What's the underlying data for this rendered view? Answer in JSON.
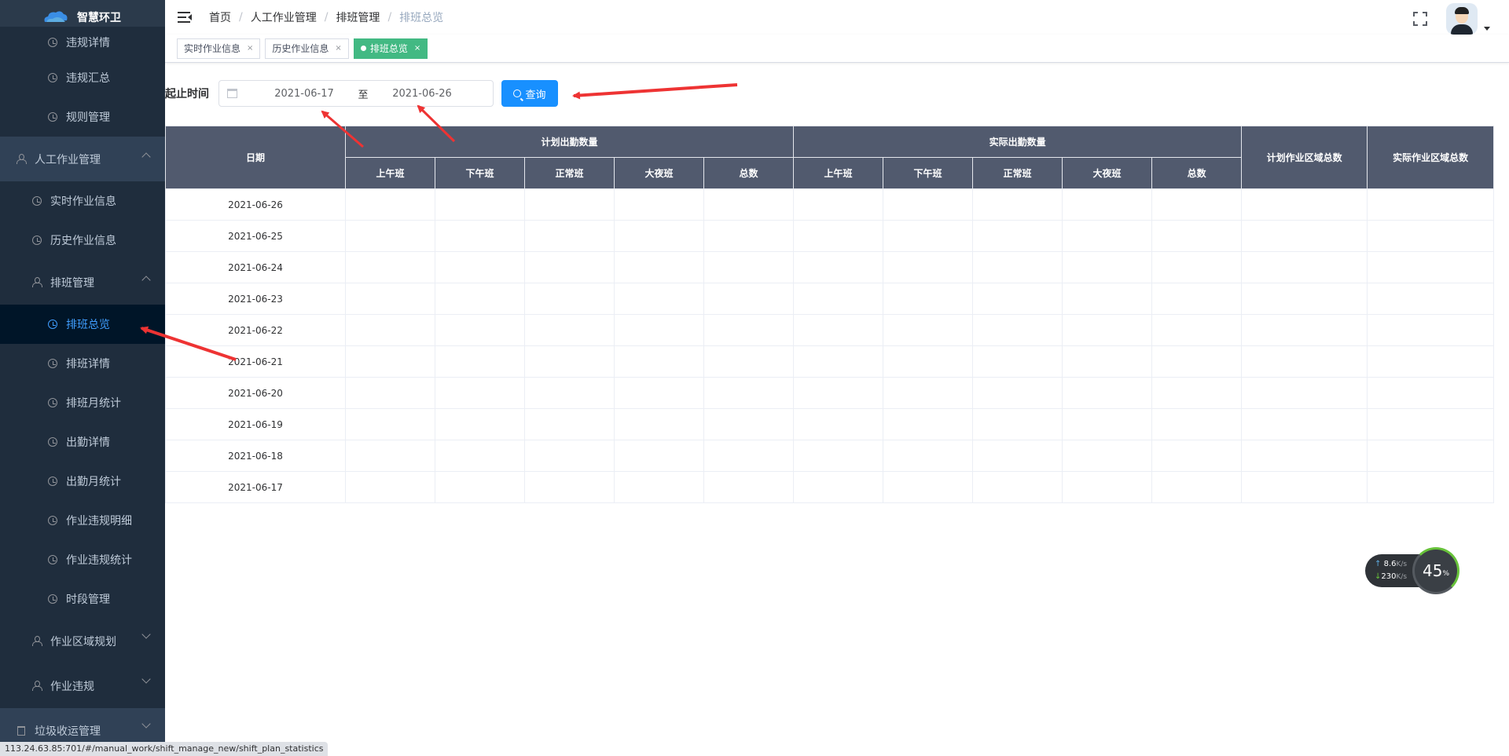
{
  "app": {
    "title": "智慧环卫"
  },
  "sidebar": {
    "items": [
      {
        "label": "违规详情",
        "level": 3,
        "icon": "clock-icon"
      },
      {
        "label": "违规汇总",
        "level": 3,
        "icon": "clock-icon"
      },
      {
        "label": "规则管理",
        "level": 3,
        "icon": "clock-icon"
      },
      {
        "label": "人工作业管理",
        "level": 1,
        "icon": "person-icon",
        "expanded": true
      },
      {
        "label": "实时作业信息",
        "level": 2,
        "icon": "clock-icon"
      },
      {
        "label": "历史作业信息",
        "level": 2,
        "icon": "clock-icon"
      },
      {
        "label": "排班管理",
        "level": 2,
        "icon": "person-icon",
        "expanded": true
      },
      {
        "label": "排班总览",
        "level": 3,
        "icon": "clock-icon",
        "active": true
      },
      {
        "label": "排班详情",
        "level": 3,
        "icon": "clock-icon"
      },
      {
        "label": "排班月统计",
        "level": 3,
        "icon": "clock-icon"
      },
      {
        "label": "出勤详情",
        "level": 3,
        "icon": "clock-icon"
      },
      {
        "label": "出勤月统计",
        "level": 3,
        "icon": "clock-icon"
      },
      {
        "label": "作业违规明细",
        "level": 3,
        "icon": "clock-icon"
      },
      {
        "label": "作业违规统计",
        "level": 3,
        "icon": "clock-icon"
      },
      {
        "label": "时段管理",
        "level": 3,
        "icon": "clock-icon"
      },
      {
        "label": "作业区域规划",
        "level": 2,
        "icon": "person-icon",
        "expanded": false
      },
      {
        "label": "作业违规",
        "level": 2,
        "icon": "person-icon",
        "expanded": false
      },
      {
        "label": "垃圾收运管理",
        "level": 1,
        "icon": "trash-icon",
        "expanded": false
      }
    ]
  },
  "header": {
    "breadcrumb": [
      "首页",
      "人工作业管理",
      "排班管理",
      "排班总览"
    ],
    "separator": "/"
  },
  "tags": [
    {
      "label": "实时作业信息",
      "active": false
    },
    {
      "label": "历史作业信息",
      "active": false
    },
    {
      "label": "排班总览",
      "active": true
    }
  ],
  "tag_close": "×",
  "filter": {
    "label": "起止时间",
    "start": "2021-06-17",
    "to": "至",
    "end": "2021-06-26",
    "query_label": "查询"
  },
  "table": {
    "date_header": "日期",
    "planned_header": "计划出勤数量",
    "actual_header": "实际出勤数量",
    "planned_area_header": "计划作业区域总数",
    "actual_area_header": "实际作业区域总数",
    "shift_headers": [
      "上午班",
      "下午班",
      "正常班",
      "大夜班",
      "总数"
    ],
    "rows": [
      "2021-06-26",
      "2021-06-25",
      "2021-06-24",
      "2021-06-23",
      "2021-06-22",
      "2021-06-21",
      "2021-06-20",
      "2021-06-19",
      "2021-06-18",
      "2021-06-17"
    ]
  },
  "speed_widget": {
    "up": "8.6",
    "down": "230",
    "unit": "K/s",
    "percent": "45",
    "percent_sign": "%"
  },
  "status_url": "113.24.63.85:701/#/manual_work/shift_manage_new/shift_plan_statistics",
  "colors": {
    "sidebar_bg": "#304156",
    "active_menu": "#409eff",
    "tag_active": "#42b983",
    "button_primary": "#1890ff",
    "table_header": "#515a6e",
    "annotation_arrow": "#ee3333"
  }
}
